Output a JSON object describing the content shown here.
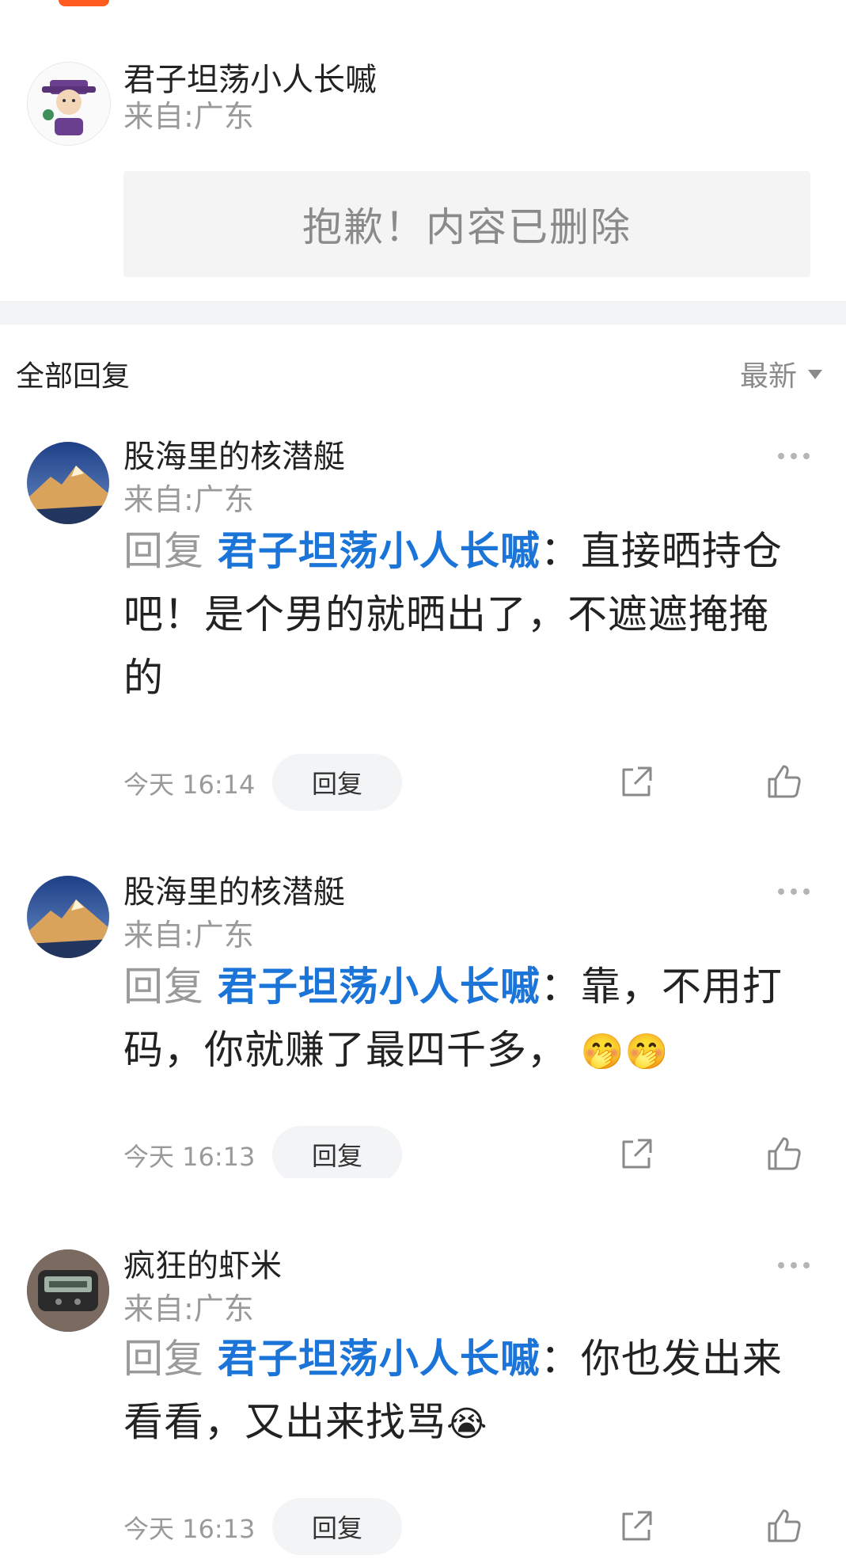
{
  "colors": {
    "accent_blue": "#1b74d8",
    "muted_gray": "#9a9a9a",
    "brand_orange": "#ff5a1f"
  },
  "original_post": {
    "username": "君子坦荡小人长嘁",
    "location": "来自:广东",
    "deleted_text": "抱歉！内容已删除"
  },
  "replies_header": {
    "title": "全部回复",
    "sort_label": "最新"
  },
  "comments": [
    {
      "username": "股海里的核潜艇",
      "location": "来自:广东",
      "reply_prefix": "回复",
      "reply_target": "君子坦荡小人长嘁",
      "text": "：直接晒持仓吧！是个男的就晒出了，不遮遮掩掩的",
      "emojis": "",
      "time": "今天 16:14",
      "reply_button": "回复"
    },
    {
      "username": "股海里的核潜艇",
      "location": "来自:广东",
      "reply_prefix": "回复",
      "reply_target": "君子坦荡小人长嘁",
      "text": "：靠，不用打码，你就赚了最四千多，",
      "emojis": "🤭🤭",
      "time": "今天 16:13",
      "reply_button": "回复"
    },
    {
      "username": "疯狂的虾米",
      "location": "来自:广东",
      "reply_prefix": "回复",
      "reply_target": "君子坦荡小人长嘁",
      "text": "：你也发出来看看，又出来找骂",
      "emojis": "😭",
      "time": "今天 16:13",
      "reply_button": "回复"
    }
  ]
}
